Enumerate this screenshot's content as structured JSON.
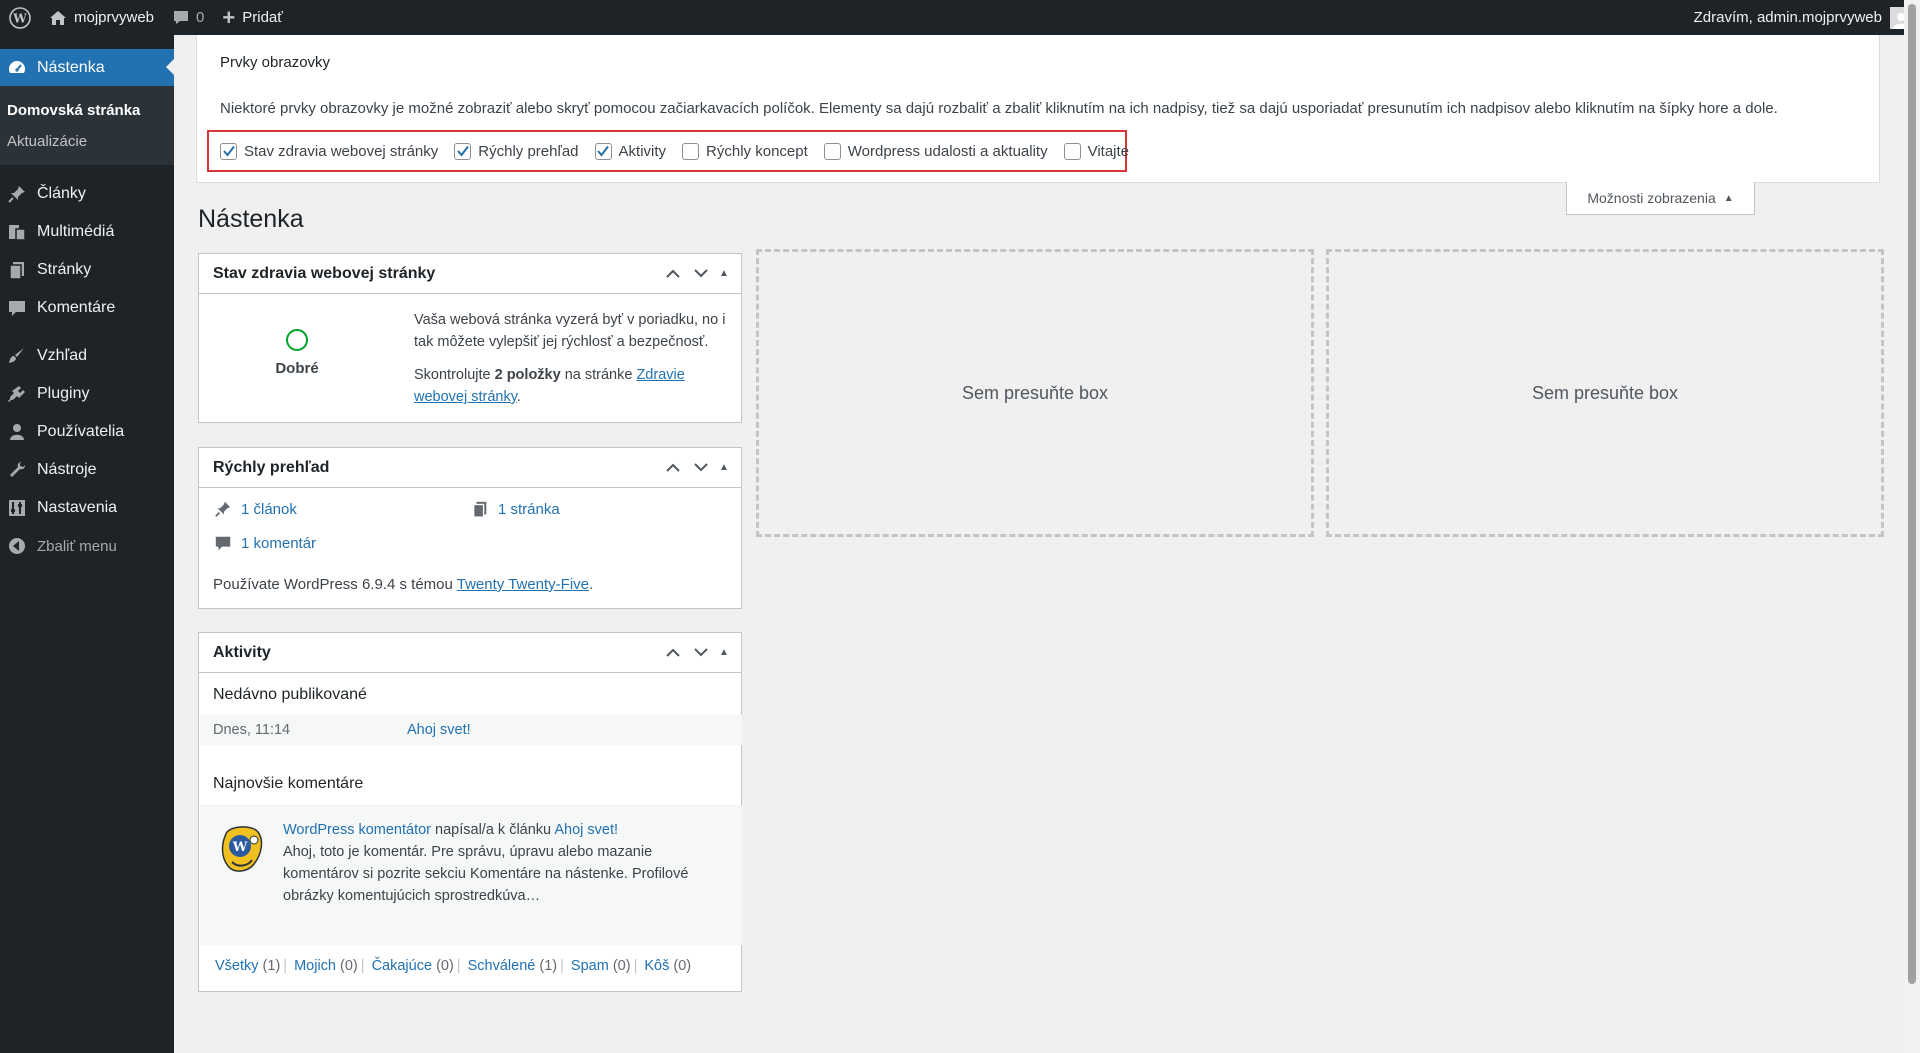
{
  "adminbar": {
    "site_name": "mojprvyweb",
    "comments_count": "0",
    "new_label": "Pridať",
    "greeting": "Zdravím, admin.mojprvyweb"
  },
  "sidebar": {
    "dashboard": "Nástenka",
    "sub_home": "Domovská stránka",
    "sub_updates": "Aktualizácie",
    "items": [
      {
        "label": "Články",
        "icon": "pin-icon"
      },
      {
        "label": "Multimédiá",
        "icon": "media-icon"
      },
      {
        "label": "Stránky",
        "icon": "pages-icon"
      },
      {
        "label": "Komentáre",
        "icon": "comment-icon"
      },
      {
        "label": "Vzhľad",
        "icon": "brush-icon"
      },
      {
        "label": "Pluginy",
        "icon": "plugin-icon"
      },
      {
        "label": "Používatelia",
        "icon": "user-icon"
      },
      {
        "label": "Nástroje",
        "icon": "wrench-icon"
      },
      {
        "label": "Nastavenia",
        "icon": "settings-icon"
      }
    ],
    "collapse": "Zbaliť menu"
  },
  "screen_options": {
    "title": "Prvky obrazovky",
    "description": "Niektoré prvky obrazovky je možné zobraziť alebo skryť pomocou začiarkavacích políčok. Elementy sa dajú rozbaliť a zbaliť kliknutím na ich nadpisy, tiež sa dajú usporiadať presunutím ich nadpisov alebo kliknutím na šípky hore a dole.",
    "checkboxes": [
      {
        "label": "Stav zdravia webovej stránky",
        "checked": true
      },
      {
        "label": "Rýchly prehľad",
        "checked": true
      },
      {
        "label": "Aktivity",
        "checked": true
      },
      {
        "label": "Rýchly koncept",
        "checked": false
      },
      {
        "label": "Wordpress udalosti a aktuality",
        "checked": false
      },
      {
        "label": "Vitajte",
        "checked": false
      }
    ],
    "toggle_label": "Možnosti zobrazenia"
  },
  "page_title": "Nástenka",
  "health": {
    "title": "Stav zdravia webovej stránky",
    "status": "Dobré",
    "text1": "Vaša webová stránka vyzerá byť v poriadku, no i tak môžete vylepšiť jej rýchlosť a bezpečnosť.",
    "text2_pre": "Skontrolujte ",
    "text2_bold": "2 položky",
    "text2_mid": " na stránke ",
    "text2_link": "Zdravie webovej stránky",
    "text2_end": "."
  },
  "glance": {
    "title": "Rýchly prehľad",
    "posts": "1 článok",
    "pages": "1 stránka",
    "comments": "1 komentár",
    "footer_pre": "Používate WordPress 6.9.4 s témou ",
    "footer_theme": "Twenty Twenty-Five",
    "footer_end": "."
  },
  "activity": {
    "title": "Aktivity",
    "recent_heading": "Nedávno publikované",
    "recent_date": "Dnes, 11:14",
    "recent_post": "Ahoj svet!",
    "comments_heading": "Najnovšie komentáre",
    "comment_author": "WordPress komentátor",
    "comment_mid": " napísal/a k článku ",
    "comment_post": "Ahoj svet!",
    "comment_excerpt": "Ahoj, toto je komentár. Pre správu, úpravu alebo mazanie komentárov si pozrite sekciu Komentáre na nástenke. Profilové obrázky komentujúcich sprostredkúva…",
    "links": [
      {
        "label": "Všetky",
        "count": "(1)"
      },
      {
        "label": "Mojich",
        "count": "(0)"
      },
      {
        "label": "Čakajúce",
        "count": "(0)"
      },
      {
        "label": "Schválené",
        "count": "(1)"
      },
      {
        "label": "Spam",
        "count": "(0)"
      },
      {
        "label": "Kôš",
        "count": "(0)"
      }
    ]
  },
  "dropzones": {
    "label1": "Sem presuňte box",
    "label2": "Sem presuňte box"
  },
  "colors": {
    "accent": "#2271b1",
    "adminbar": "#1d2327",
    "highlight_border": "#d63638",
    "health_good": "#00a32a"
  }
}
